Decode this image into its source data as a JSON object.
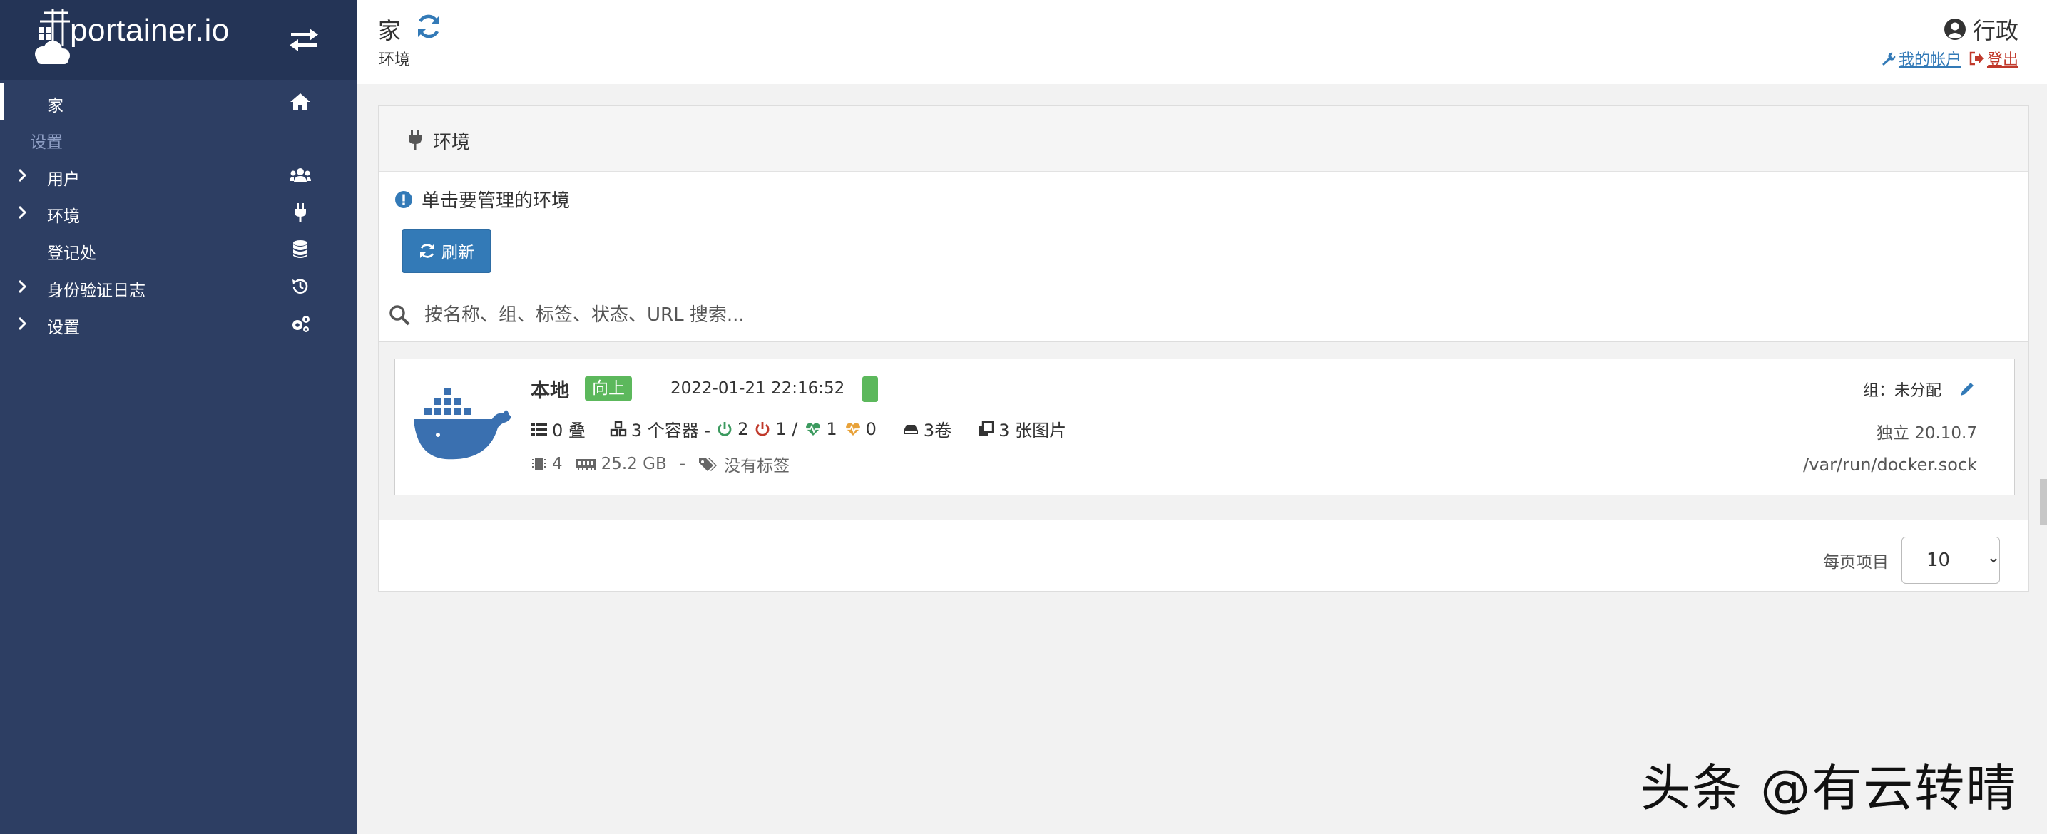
{
  "brand": {
    "name": "portainer.io"
  },
  "sidebar": {
    "home_label": "家",
    "section_label": "设置",
    "items": [
      {
        "label": "用户",
        "icon": "users-icon"
      },
      {
        "label": "环境",
        "icon": "plug-icon"
      },
      {
        "label": "登记处",
        "icon": "database-icon"
      },
      {
        "label": "身份验证日志",
        "icon": "history-icon"
      },
      {
        "label": "设置",
        "icon": "gears-icon"
      }
    ]
  },
  "header": {
    "title": "家",
    "breadcrumb": "环境",
    "user": "行政",
    "account_link": "我的帐户",
    "logout_link": "登出"
  },
  "widget": {
    "title": "环境",
    "info": "单击要管理的环境",
    "refresh_label": "刷新",
    "search_placeholder": "按名称、组、标签、状态、URL 搜索..."
  },
  "environment": {
    "name": "本地",
    "status": "向上",
    "timestamp": "2022-01-21 22:16:52",
    "stacks": "0 叠",
    "containers": "3 个容器 -",
    "running": "2",
    "stopped": "1 /",
    "healthy": "1",
    "unhealthy": "0",
    "volumes": "3卷",
    "images": "3 张图片",
    "cpu": "4",
    "memory": "25.2 GB",
    "meta_sep": "-",
    "tags": "没有标签",
    "group": "组：未分配",
    "version": "独立 20.10.7",
    "socket": "/var/run/docker.sock"
  },
  "pagination": {
    "label": "每页项目",
    "selected": "10",
    "options": [
      "10"
    ]
  },
  "watermark": "头条 @有云转晴",
  "colors": {
    "sidebar": "#2d3e63",
    "sidebar_brand": "#243456",
    "primary": "#337ab7",
    "success": "#5cb85c",
    "danger": "#c0392b",
    "docker_blue": "#3a70b0"
  }
}
